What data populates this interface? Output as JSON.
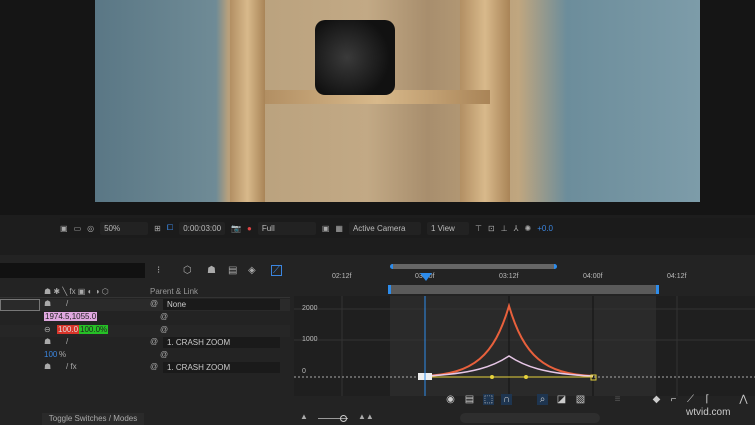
{
  "viewer_toolbar": {
    "zoom": "50%",
    "timecode": "0:00:03:00",
    "resolution": "Full",
    "camera": "Active Camera",
    "views": "1 View",
    "exposure": "+0.0"
  },
  "timeline": {
    "column_header": "Parent & Link",
    "rows": [
      {
        "parent": "None"
      },
      {
        "value": "1974.5,1055.0"
      },
      {
        "value_x": "100.0",
        "value_y": "100.0%"
      },
      {
        "parent": "1. CRASH ZOOM"
      },
      {
        "value": "100",
        "unit": "%"
      },
      {
        "parent": "1. CRASH ZOOM"
      }
    ],
    "toggle_label": "Toggle Switches / Modes",
    "ruler_ticks": [
      "02:12f",
      "03:00f",
      "03:12f",
      "04:00f",
      "04:12f"
    ],
    "graph_values": [
      "2000",
      "1000",
      "0"
    ]
  },
  "colors": {
    "accent": "#2d8ceb",
    "curve_speed": "#e8603c",
    "curve_value": "#e6c6e6",
    "keyframe": "#e6d23c"
  },
  "watermark": "wtvid.com"
}
